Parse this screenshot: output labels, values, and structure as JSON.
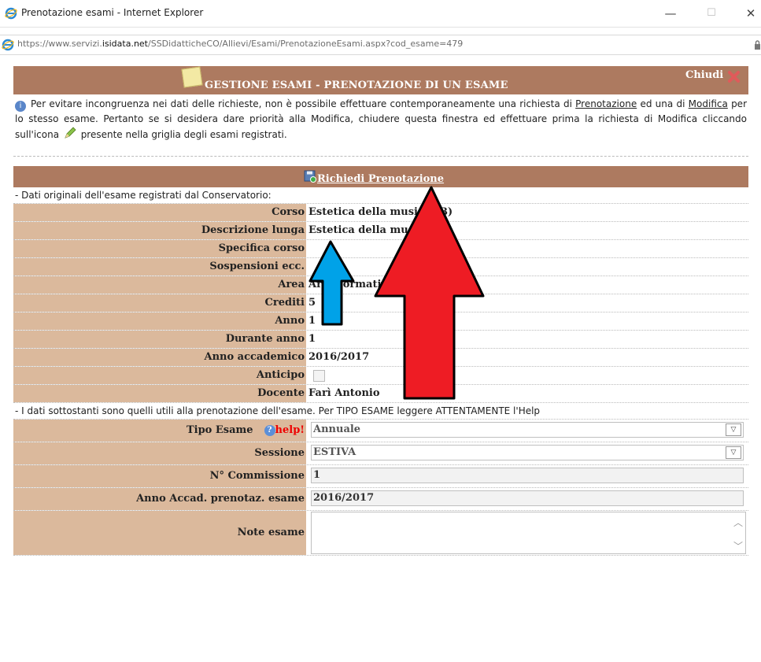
{
  "window": {
    "title": "Prenotazione esami - Internet Explorer",
    "minimize": "—",
    "maximize": "☐",
    "close": "✕"
  },
  "address": {
    "prefix": "https://www.servizi.",
    "host": "isidata.net",
    "path": "/SSDidatticheCO/Allievi/Esami/PrenotazioneEsami.aspx?cod_esame=479"
  },
  "header": {
    "title": "GESTIONE ESAMI - PRENOTAZIONE DI UN ESAME",
    "close_label": "Chiudi"
  },
  "info": {
    "part1": "Per evitare incongruenza nei dati delle richieste, non è possibile effettuare contemporaneamente una richiesta di ",
    "link1": "Prenotazione",
    "part2": " ed una di ",
    "link2": "Modifica",
    "part3": " per lo stesso esame. Pertanto se si desidera dare priorità alla Modifica, chiudere questa finestra ed effettuare prima la richiesta di Modifica cliccando sull'icona ",
    "part4": " presente nella griglia degli esami registrati."
  },
  "action": {
    "label": "Richiedi Prenotazione"
  },
  "original": {
    "caption": "- Dati originali dell'esame registrati dal Conservatorio:",
    "rows": [
      {
        "label": "Corso",
        "value": "Estetica della musica (B)"
      },
      {
        "label": "Descrizione lunga",
        "value": "Estetica della musica"
      },
      {
        "label": "Specifica corso",
        "value": ""
      },
      {
        "label": "Sospensioni ecc.",
        "value": ""
      },
      {
        "label": "Area",
        "value": "Area formativa"
      },
      {
        "label": "Crediti",
        "value": "5"
      },
      {
        "label": "Anno",
        "value": "1"
      },
      {
        "label": "Durante anno",
        "value": "1"
      },
      {
        "label": "Anno accademico",
        "value": "2016/2017"
      }
    ],
    "anticipo_label": "Anticipo",
    "anticipo_checked": false,
    "docente_label": "Docente",
    "docente_value": "Farì Antonio"
  },
  "booking": {
    "caption": "- I dati sottostanti sono quelli utili alla prenotazione dell'esame. Per TIPO ESAME leggere ATTENTAMENTE l'Help",
    "tipo_label": "Tipo Esame",
    "help_label": "help!",
    "tipo_value": "Annuale",
    "sessione_label": "Sessione",
    "sessione_value": "ESTIVA",
    "commissione_label": "N° Commissione",
    "commissione_value": "1",
    "anno_label": "Anno Accad. prenotaz. esame",
    "anno_value": "2016/2017",
    "note_label": "Note esame",
    "note_value": ""
  },
  "annotation_colors": {
    "red_arrow": "#ee1c24",
    "blue_arrow": "#00a2e8",
    "header_bg": "#ad7a60",
    "label_bg": "#dbb99c"
  }
}
